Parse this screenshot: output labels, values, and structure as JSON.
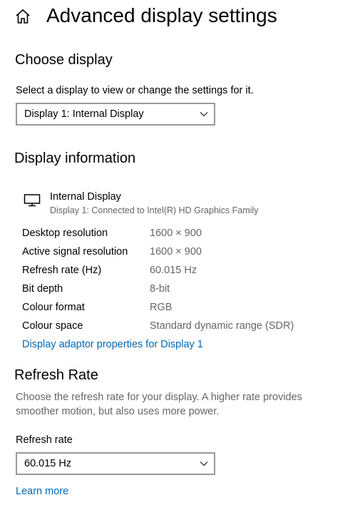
{
  "header": {
    "title": "Advanced display settings"
  },
  "choose_display": {
    "heading": "Choose display",
    "instruction": "Select a display to view or change the settings for it.",
    "selected": "Display 1: Internal Display"
  },
  "display_information": {
    "heading": "Display information",
    "display_name": "Internal Display",
    "display_subtitle": "Display 1: Connected to Intel(R) HD Graphics Family",
    "rows": [
      {
        "label": "Desktop resolution",
        "value": "1600 × 900"
      },
      {
        "label": "Active signal resolution",
        "value": "1600 × 900"
      },
      {
        "label": "Refresh rate (Hz)",
        "value": "60.015 Hz"
      },
      {
        "label": "Bit depth",
        "value": "8-bit"
      },
      {
        "label": "Colour format",
        "value": "RGB"
      },
      {
        "label": "Colour space",
        "value": "Standard dynamic range (SDR)"
      }
    ],
    "adapter_link": "Display adaptor properties for Display 1"
  },
  "refresh_rate": {
    "heading": "Refresh Rate",
    "description": "Choose the refresh rate for your display. A higher rate provides smoother motion, but also uses more power.",
    "field_label": "Refresh rate",
    "selected": "60.015 Hz",
    "learn_more": "Learn more"
  },
  "icons": {
    "home": "home-icon",
    "monitor": "monitor-icon",
    "dropdown": "chevron-down-icon"
  },
  "colors": {
    "link": "#0067b8",
    "muted_text": "#666666",
    "select_border": "#999999"
  }
}
